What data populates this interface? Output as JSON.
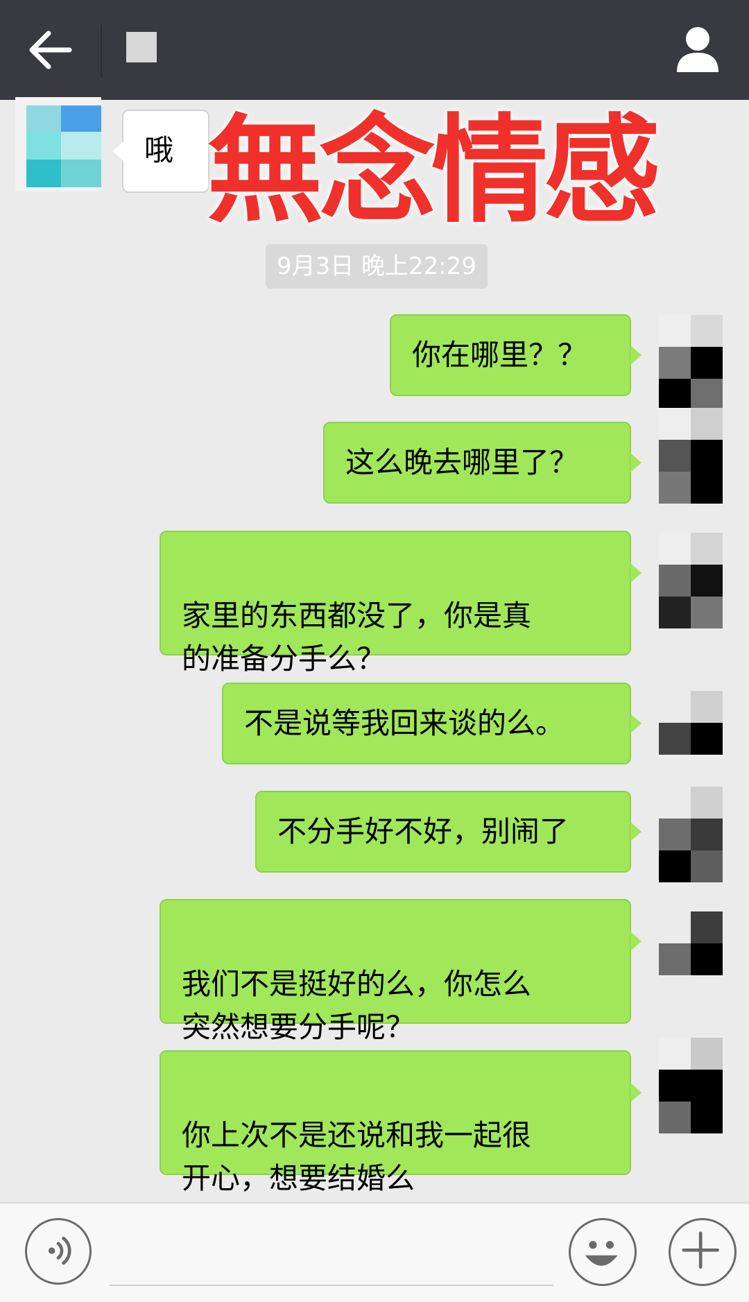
{
  "header": {
    "back_icon": "arrow-left-icon",
    "profile_icon": "person-icon",
    "title": ""
  },
  "overlay_title": "無念情感",
  "first_message": "哦",
  "timestamp": "9月3日 晚上22:29",
  "messages": [
    {
      "text": "你在哪里？？"
    },
    {
      "text": "这么晚去哪里了？"
    },
    {
      "text": "家里的东西都没了，你是真\n的准备分手么？"
    },
    {
      "text": "不是说等我回来谈的么。"
    },
    {
      "text": "不分手好不好，别闹了"
    },
    {
      "text": "我们不是挺好的么，你怎么\n突然想要分手呢？"
    },
    {
      "text": "你上次不是还说和我一起很\n开心，想要结婚么"
    }
  ],
  "colors": {
    "header_bg": "#393a3f",
    "chat_bg": "#ebebeb",
    "outgoing_bubble": "#a0e75a",
    "overlay_red": "#f0302a"
  },
  "toolbar": {
    "voice_icon": "voice-icon",
    "emoji_icon": "smiley-icon",
    "more_icon": "plus-icon"
  }
}
